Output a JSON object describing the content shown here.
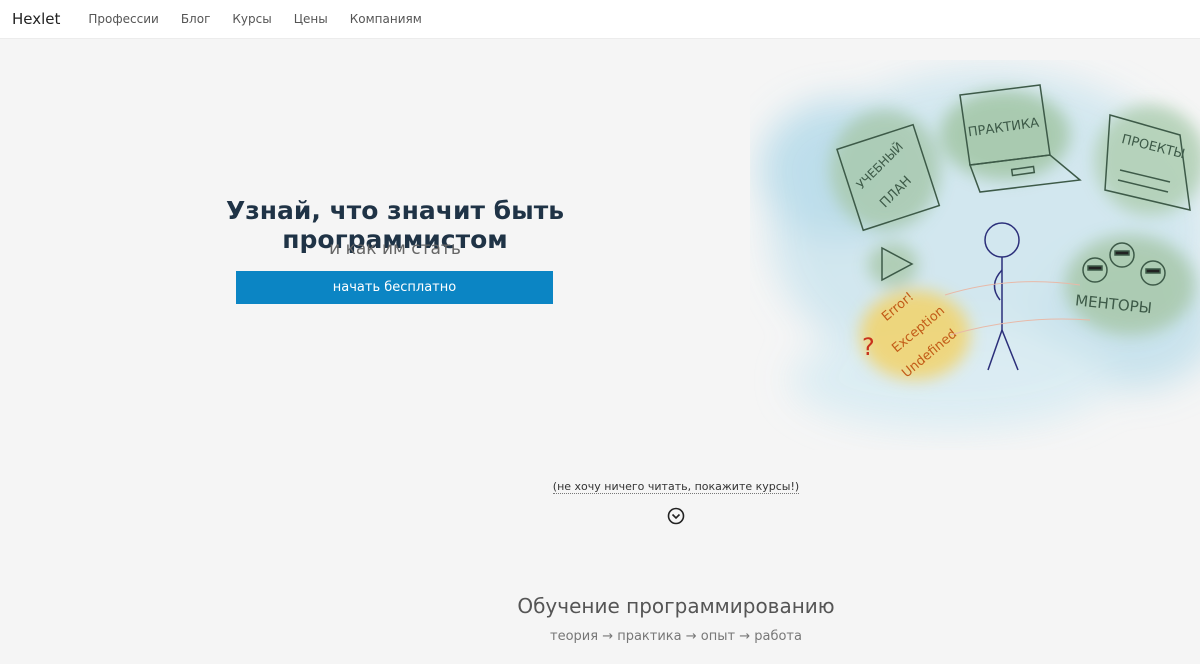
{
  "nav": {
    "brand": "Hexlet",
    "links": [
      "Профессии",
      "Блог",
      "Курсы",
      "Цены",
      "Компаниям"
    ]
  },
  "hero": {
    "title": "Узнай, что значит быть программистом",
    "subtitle": "и как им стать",
    "cta": "начать бесплатно"
  },
  "illustration": {
    "labels": [
      "УЧЕБНЫЙ",
      "ПЛАН",
      "ПРАКТИКА",
      "ПРОЕКТЫ",
      "МЕНТОРЫ",
      "Error!",
      "Exception",
      "Undefined",
      "?"
    ]
  },
  "skip_link": "(не хочу ничего читать, покажите курсы!)",
  "section": {
    "title": "Обучение программированию",
    "subtitle": "теория → практика → опыт → работа"
  },
  "colors": {
    "accent": "#0b85c4",
    "title": "#1f3346"
  }
}
